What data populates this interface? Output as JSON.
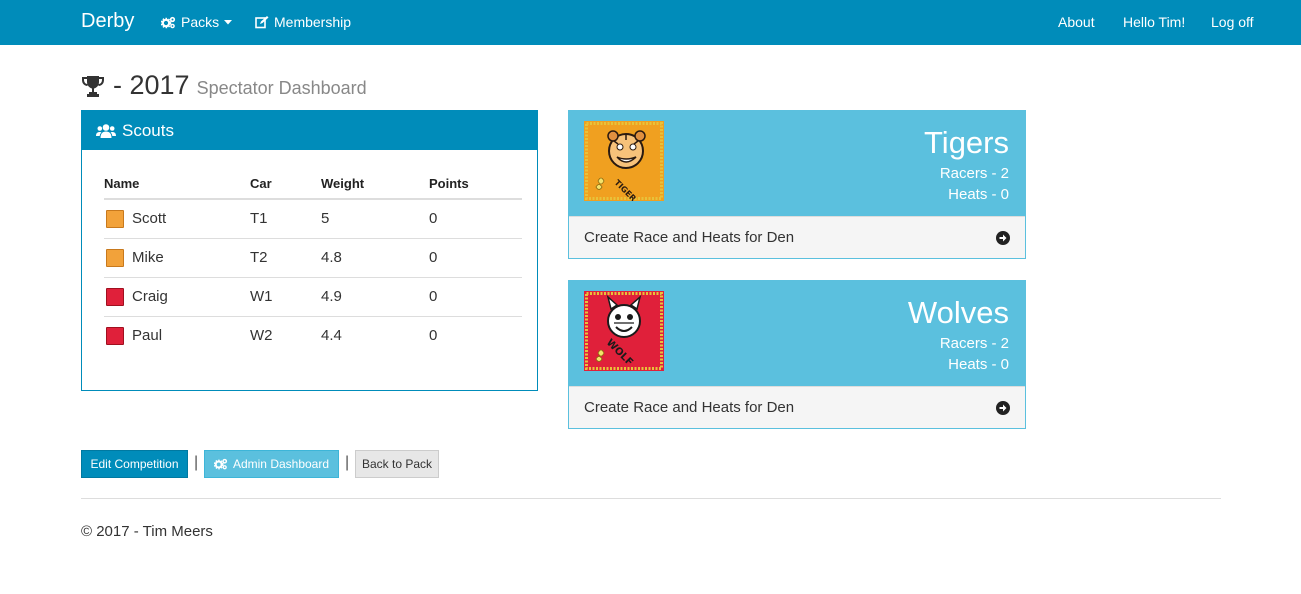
{
  "navbar": {
    "brand": "Derby",
    "packs_label": "Packs",
    "membership_label": "Membership",
    "about_label": "About",
    "hello_label": "Hello Tim!",
    "logoff_label": "Log off"
  },
  "page": {
    "title_year": "- 2017",
    "title_sub": "Spectator Dashboard"
  },
  "scouts": {
    "heading": "Scouts",
    "columns": [
      "Name",
      "Car",
      "Weight",
      "Points"
    ],
    "rows": [
      {
        "name": "Scott",
        "car": "T1",
        "weight": "5",
        "points": "0",
        "den": "tiger"
      },
      {
        "name": "Mike",
        "car": "T2",
        "weight": "4.8",
        "points": "0",
        "den": "tiger"
      },
      {
        "name": "Craig",
        "car": "W1",
        "weight": "4.9",
        "points": "0",
        "den": "wolf"
      },
      {
        "name": "Paul",
        "car": "W2",
        "weight": "4.4",
        "points": "0",
        "den": "wolf"
      }
    ]
  },
  "dens": [
    {
      "name": "Tigers",
      "racers": "Racers - 2",
      "heats": "Heats - 0",
      "action": "Create Race and Heats for Den",
      "patch_text": "TIGER CUB"
    },
    {
      "name": "Wolves",
      "racers": "Racers - 2",
      "heats": "Heats - 0",
      "action": "Create Race and Heats for Den",
      "patch_text": "WOLF"
    }
  ],
  "actions": {
    "edit_label": "Edit Competition",
    "admin_label": "Admin Dashboard",
    "back_label": "Back to Pack",
    "separator": "|"
  },
  "footer": {
    "text": "© 2017 - Tim Meers"
  },
  "colors": {
    "primary": "#008cba",
    "info": "#5bc0de"
  }
}
